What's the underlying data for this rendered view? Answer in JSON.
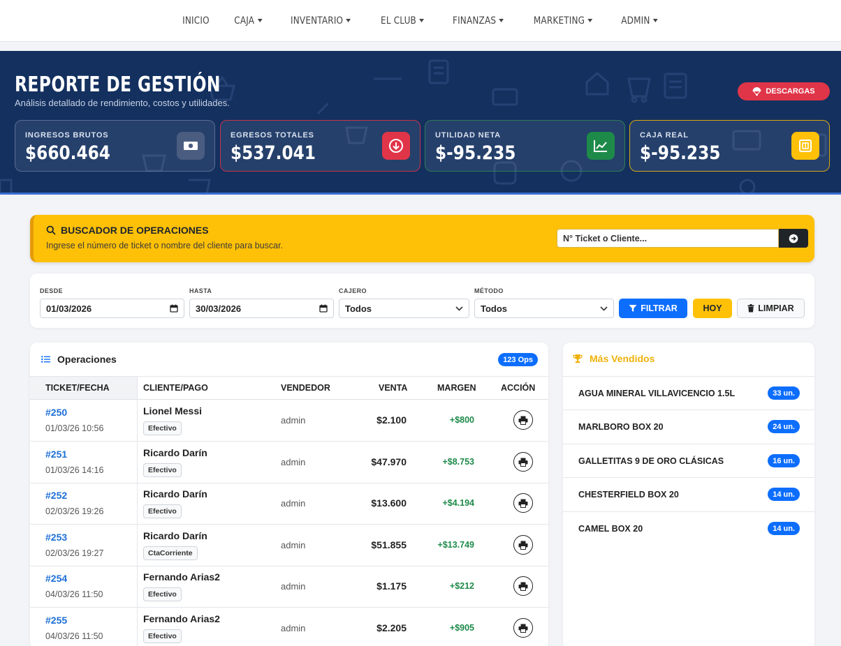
{
  "nav": {
    "items": [
      {
        "label": "INICIO",
        "dropdown": false
      },
      {
        "label": "CAJA",
        "dropdown": true
      },
      {
        "label": "INVENTARIO",
        "dropdown": true
      },
      {
        "label": "EL CLUB",
        "dropdown": true
      },
      {
        "label": "FINANZAS",
        "dropdown": true
      },
      {
        "label": "MARKETING",
        "dropdown": true
      },
      {
        "label": "ADMIN",
        "dropdown": true
      }
    ]
  },
  "hero": {
    "title": "REPORTE DE GESTIÓN",
    "subtitle": "Análisis detallado de rendimiento, costos y utilidades.",
    "download_label": "DESCARGAS",
    "kpis": [
      {
        "label": "INGRESOS BRUTOS",
        "value": "$660.464",
        "icon": "money-bill-icon",
        "accent": "#4a5d80"
      },
      {
        "label": "EGRESOS TOTALES",
        "value": "$537.041",
        "icon": "arrow-circle-down-icon",
        "accent": "#e03548"
      },
      {
        "label": "UTILIDAD NETA",
        "value": "$-95.235",
        "icon": "chart-line-icon",
        "accent": "#1e8a4a"
      },
      {
        "label": "CAJA REAL",
        "value": "$-95.235",
        "icon": "cash-register-icon",
        "accent": "#ffc107"
      }
    ]
  },
  "search": {
    "title": "BUSCADOR DE OPERACIONES",
    "subtitle": "Ingrese el número de ticket o nombre del cliente para buscar.",
    "placeholder": "N° Ticket o Cliente..."
  },
  "filters": {
    "desde_label": "DESDE",
    "desde_value": "01/03/2026",
    "hasta_label": "HASTA",
    "hasta_value": "30/03/2026",
    "cajero_label": "CAJERO",
    "cajero_value": "Todos",
    "metodo_label": "MÉTODO",
    "metodo_value": "Todos",
    "filter_button": "FILTRAR",
    "today_button": "HOY",
    "clear_button": "LIMPIAR"
  },
  "operations": {
    "title": "Operaciones",
    "count_badge": "123 Ops",
    "columns": [
      "TICKET/FECHA",
      "CLIENTE/PAGO",
      "VENDEDOR",
      "VENTA",
      "MARGEN",
      "ACCIÓN"
    ],
    "rows": [
      {
        "ticket": "#250",
        "date": "01/03/26 10:56",
        "client": "Lionel Messi",
        "payment": "Efectivo",
        "seller": "admin",
        "sale": "$2.100",
        "margin": "+$800"
      },
      {
        "ticket": "#251",
        "date": "01/03/26 14:16",
        "client": "Ricardo Darín",
        "payment": "Efectivo",
        "seller": "admin",
        "sale": "$47.970",
        "margin": "+$8.753"
      },
      {
        "ticket": "#252",
        "date": "02/03/26 19:26",
        "client": "Ricardo Darín",
        "payment": "Efectivo",
        "seller": "admin",
        "sale": "$13.600",
        "margin": "+$4.194"
      },
      {
        "ticket": "#253",
        "date": "02/03/26 19:27",
        "client": "Ricardo Darín",
        "payment": "CtaCorriente",
        "seller": "admin",
        "sale": "$51.855",
        "margin": "+$13.749"
      },
      {
        "ticket": "#254",
        "date": "04/03/26 11:50",
        "client": "Fernando Arias2",
        "payment": "Efectivo",
        "seller": "admin",
        "sale": "$1.175",
        "margin": "+$212"
      },
      {
        "ticket": "#255",
        "date": "04/03/26 11:50",
        "client": "Fernando Arias2",
        "payment": "Efectivo",
        "seller": "admin",
        "sale": "$2.205",
        "margin": "+$905"
      }
    ]
  },
  "top_sellers": {
    "title": "Más Vendidos",
    "items": [
      {
        "name": "AGUA MINERAL VILLAVICENCIO 1.5L",
        "qty": "33 un."
      },
      {
        "name": "MARLBORO BOX 20",
        "qty": "24 un."
      },
      {
        "name": "GALLETITAS 9 DE ORO CLÁSICAS",
        "qty": "16 un."
      },
      {
        "name": "CHESTERFIELD BOX 20",
        "qty": "14 un."
      },
      {
        "name": "CAMEL BOX 20",
        "qty": "14 un."
      }
    ]
  }
}
